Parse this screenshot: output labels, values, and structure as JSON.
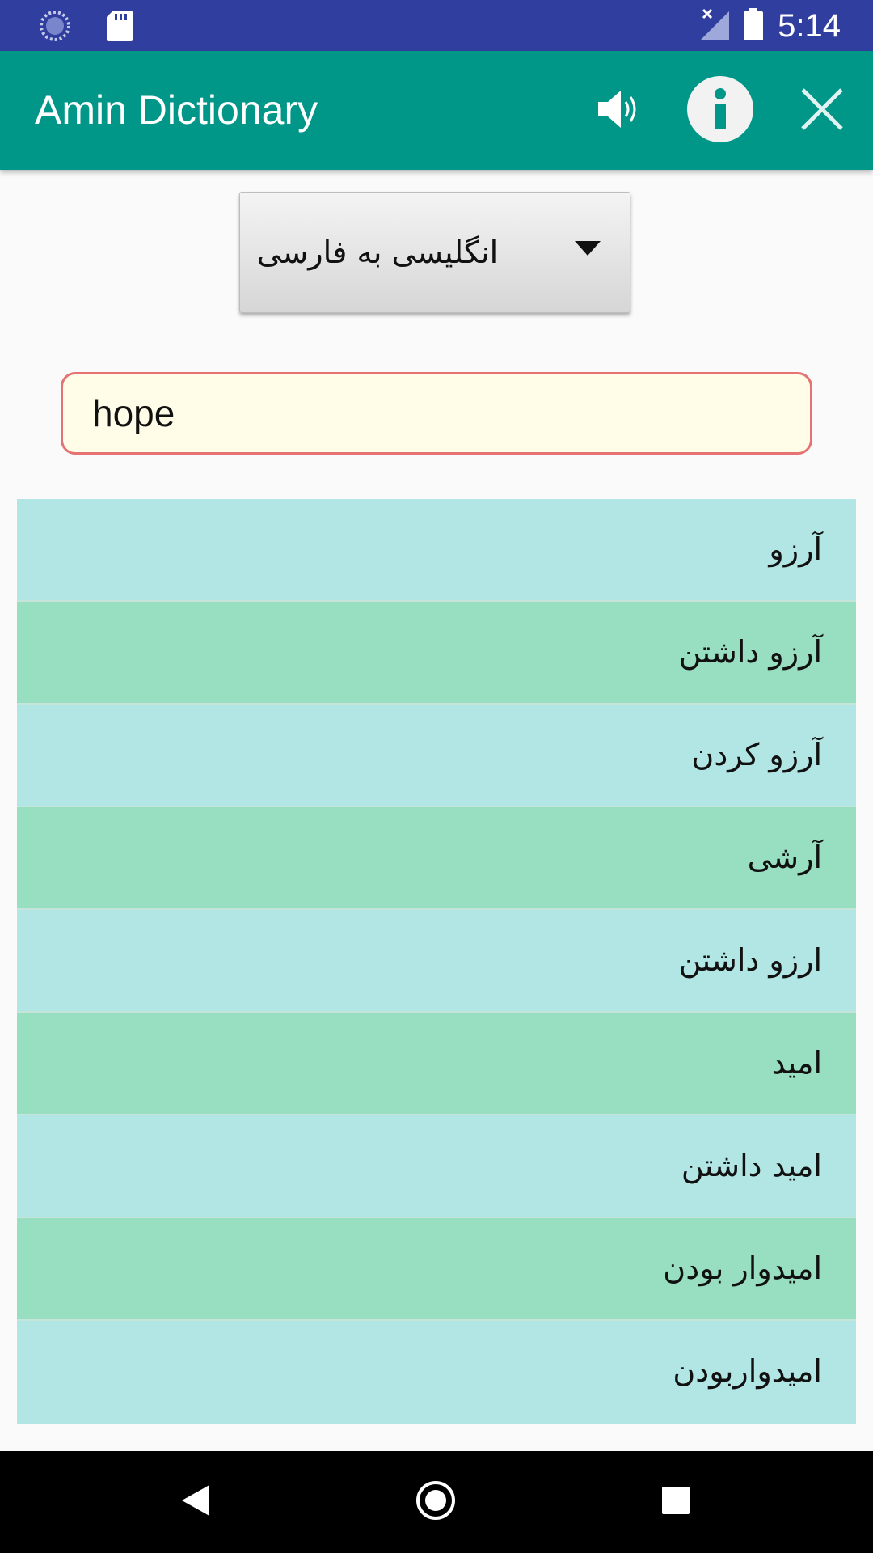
{
  "status_bar": {
    "time": "5:14",
    "icons": [
      "loading-icon",
      "sd-card-icon",
      "no-signal-icon",
      "battery-icon"
    ]
  },
  "app_bar": {
    "title": "Amin Dictionary",
    "actions": [
      "speaker-icon",
      "info-icon",
      "close-icon"
    ]
  },
  "language_selector": {
    "selected": "انگلیسی به فارسی"
  },
  "search": {
    "value": "hope"
  },
  "results": [
    "آرزو",
    "آرزو داشتن",
    "آرزو کردن",
    "آرشی",
    "ارزو داشتن",
    "امید",
    "امید داشتن",
    "امیدوار بودن",
    "امیدواربودن"
  ],
  "colors": {
    "status_bar": "#303f9f",
    "app_bar": "#009688",
    "row_odd": "#b2e6e4",
    "row_even": "#98dec0",
    "search_border": "#e57373",
    "search_bg": "#fffde7"
  },
  "nav_bar": {
    "buttons": [
      "back-icon",
      "home-icon",
      "recent-apps-icon"
    ]
  }
}
